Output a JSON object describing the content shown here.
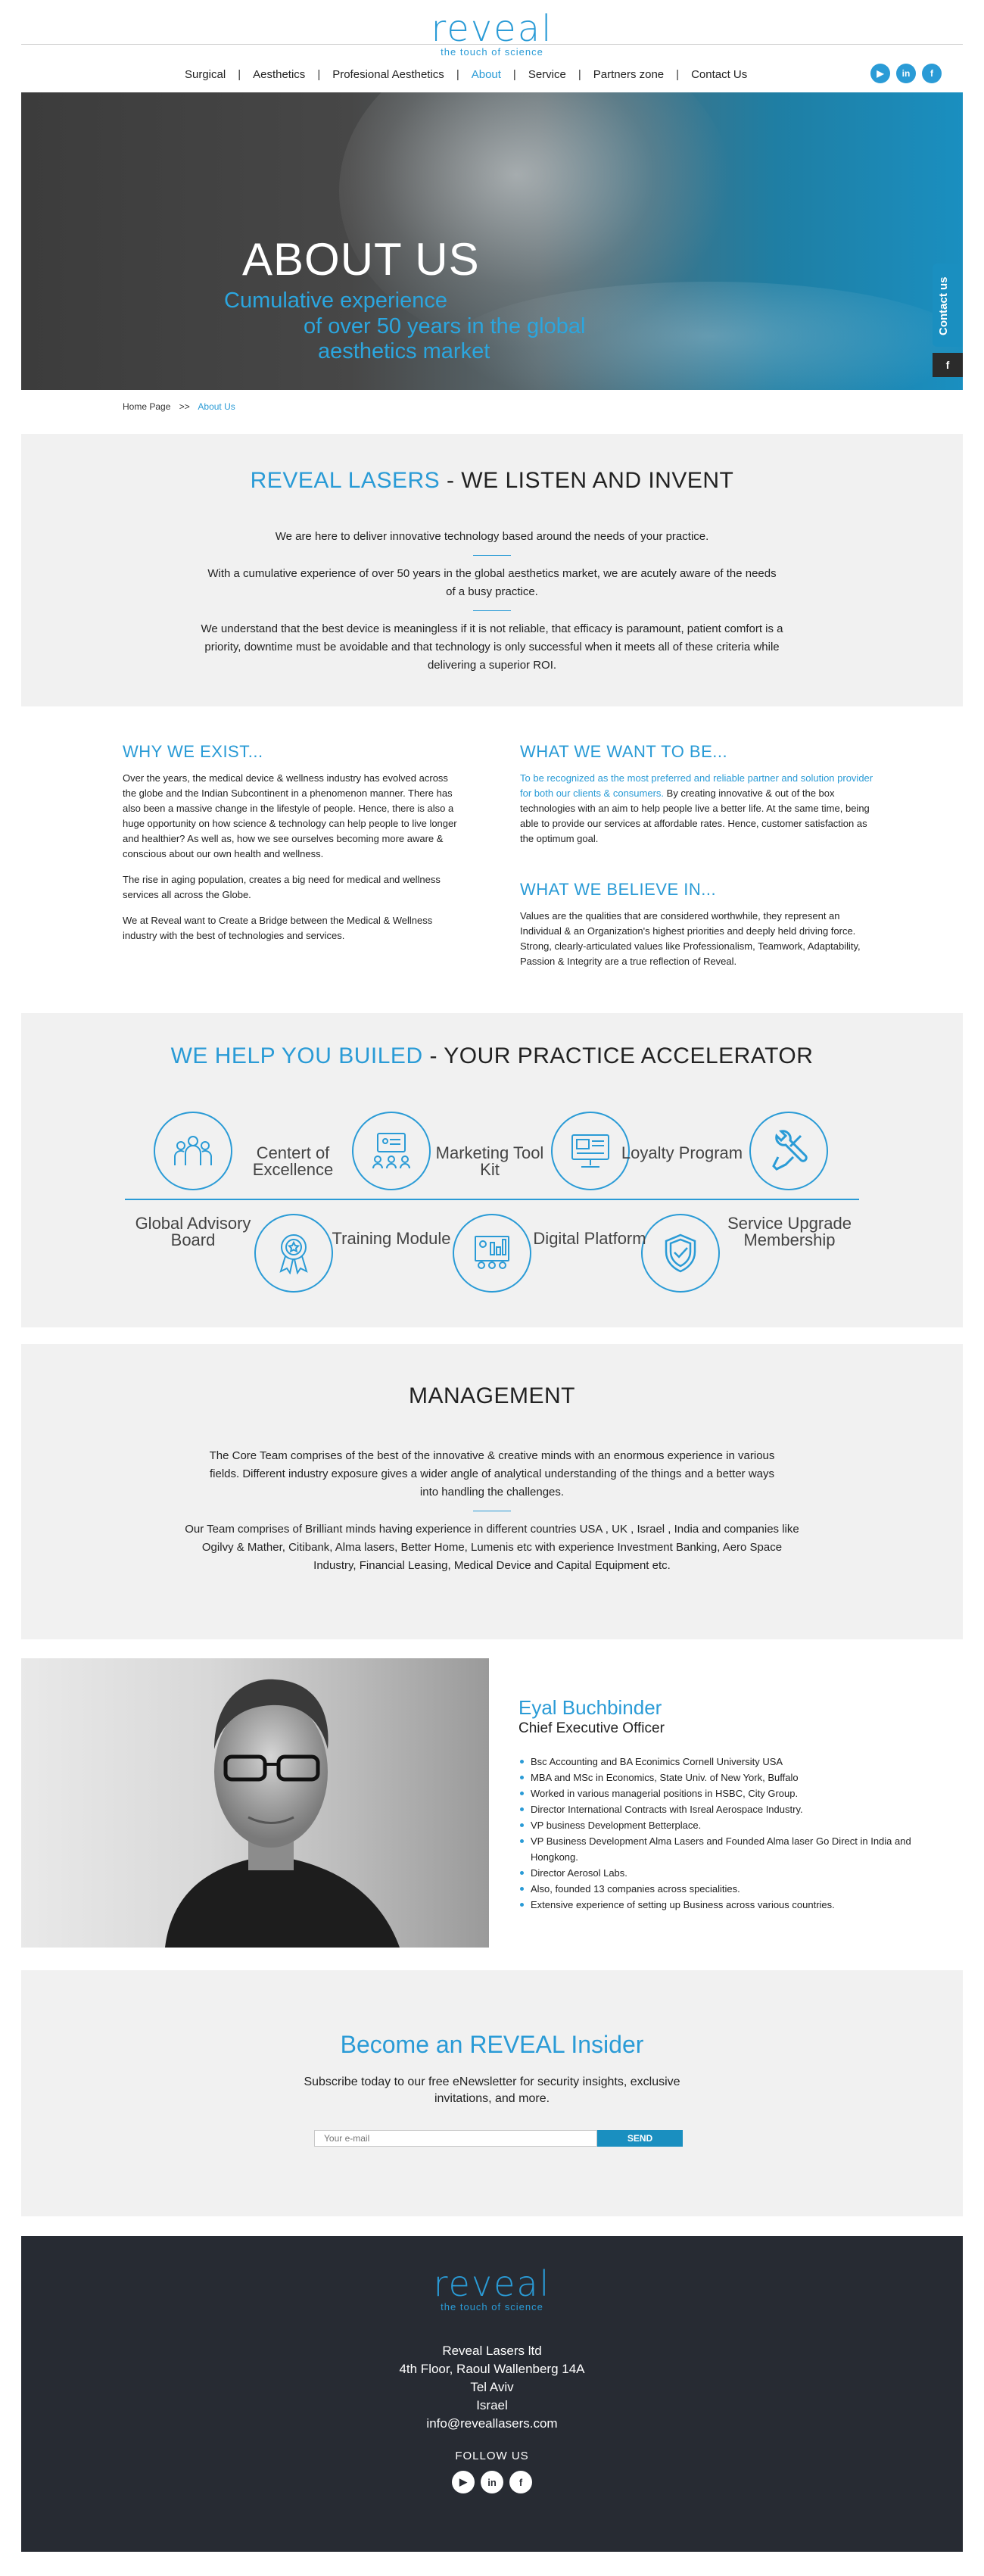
{
  "header": {
    "logo_word": "reveal",
    "logo_tagline": "the touch of science",
    "nav": [
      {
        "label": "Surgical"
      },
      {
        "label": "Aesthetics"
      },
      {
        "label": "Profesional Aesthetics"
      },
      {
        "label": "About",
        "active": true
      },
      {
        "label": "Service"
      },
      {
        "label": "Partners zone"
      },
      {
        "label": "Contact Us"
      }
    ],
    "social": [
      "youtube-icon",
      "linkedin-icon",
      "facebook-icon"
    ]
  },
  "hero": {
    "title": "ABOUT US",
    "subtitle_lines": [
      "Cumulative experience",
      "of over 50 years in the global",
      "aesthetics market"
    ],
    "contact_tab": "Contact us"
  },
  "breadcrumb": {
    "home": "Home Page",
    "sep": ">>",
    "current": "About Us"
  },
  "intro": {
    "title_blue": "REVEAL LASERS",
    "title_rest": " - WE LISTEN AND INVENT",
    "p1": "We are here to deliver innovative technology based around the needs of your practice.",
    "p2": "With a cumulative experience of over 50 years in the global aesthetics market, we are acutely aware of the needs of a busy practice.",
    "p3": "We understand that the best device is meaningless if it is not reliable, that efficacy is paramount, patient comfort is a priority, downtime must be avoidable and that technology is only successful when it meets all of these criteria while delivering a superior ROI."
  },
  "why": {
    "title": "WHY WE EXIST...",
    "p1": "Over the years, the medical device & wellness industry has evolved across the globe and the Indian Subcontinent in a phenomenon manner. There has also been a massive change in the lifestyle of people. Hence, there is also a huge opportunity on how science & technology can help people to live longer and healthier? As well as, how we see ourselves becoming more aware & conscious about our own health and wellness.",
    "p2": "The rise in aging population, creates a big need for medical and wellness services all across the Globe.",
    "p3": "We at Reveal want to Create a Bridge between the Medical & Wellness industry with the best of technologies and services."
  },
  "want": {
    "title": "WHAT WE WANT TO BE...",
    "p1_blue": "To be recognized as the most preferred and reliable partner and solution provider for both our clients & consumers.",
    "p1_rest": " By creating innovative & out of the box technologies with an aim to help people live a better life. At the same time, being able to provide our services at affordable rates. Hence, customer satisfaction as the optimum goal."
  },
  "believe": {
    "title": "WHAT WE BELIEVE IN...",
    "p1": "Values are the qualities that are considered worthwhile, they represent an Individual & an Organization's highest priorities and deeply held driving force. Strong, clearly-articulated values like Professionalism, Teamwork, Adaptability, Passion & Integrity are a true reflection of Reveal."
  },
  "accelerator": {
    "title_blue": "WE HELP YOU BUILED",
    "title_rest": " - YOUR PRACTICE ACCELERATOR",
    "top_labels": [
      "Centert of Excellence",
      "Marketing Tool Kit",
      "Loyalty Program"
    ],
    "bottom_labels": [
      "Global Advisory Board",
      "Training Module",
      "Digital Platform",
      "Service Upgrade Membership"
    ],
    "top_icons": [
      "team-icon",
      "network-icon",
      "computer-icon",
      "tools-icon"
    ],
    "bottom_icons": [
      "award-icon",
      "training-icon",
      "shield-check-icon"
    ]
  },
  "management": {
    "title": "MANAGEMENT",
    "p1": "The Core Team comprises of the best of the innovative & creative minds with an enormous experience in various fields. Different industry exposure gives a wider angle of analytical understanding of the things and a better ways into handling the challenges.",
    "p2": "Our Team comprises of Brilliant minds having experience in different countries USA , UK , Israel , India and companies like Ogilvy & Mather, Citibank, Alma lasers, Better Home, Lumenis etc with experience Investment Banking, Aero Space Industry, Financial Leasing, Medical Device and Capital Equipment etc."
  },
  "person": {
    "name": "Eyal Buchbinder",
    "role": "Chief Executive Officer",
    "bullets": [
      "Bsc Accounting and BA Econimics Cornell University USA",
      "MBA and MSc in Economics, State Univ. of New York, Buffalo",
      "Worked in various managerial positions in HSBC, City Group.",
      "Director International Contracts with Isreal Aerospace Industry.",
      "VP business Development Betterplace.",
      "VP Business Development Alma Lasers and Founded Alma laser Go Direct in India and Hongkong.",
      "Director Aerosol Labs.",
      "Also, founded 13 companies across specialities.",
      "Extensive experience of setting up Business across various countries."
    ]
  },
  "newsletter": {
    "title": "Become an REVEAL Insider",
    "text": "Subscribe today to our free eNewsletter for security insights, exclusive invitations, and more.",
    "placeholder": "Your e-mail",
    "button": "SEND"
  },
  "footer": {
    "company": "Reveal Lasers ltd",
    "address1": "4th Floor, Raoul Wallenberg 14A",
    "city": "Tel Aviv",
    "country": "Israel",
    "email": "info@reveallasers.com",
    "follow": "FOLLOW US"
  },
  "colors": {
    "accent": "#2a9bd6",
    "footer_bg": "#272b33",
    "section_bg": "#f1f1f1"
  }
}
